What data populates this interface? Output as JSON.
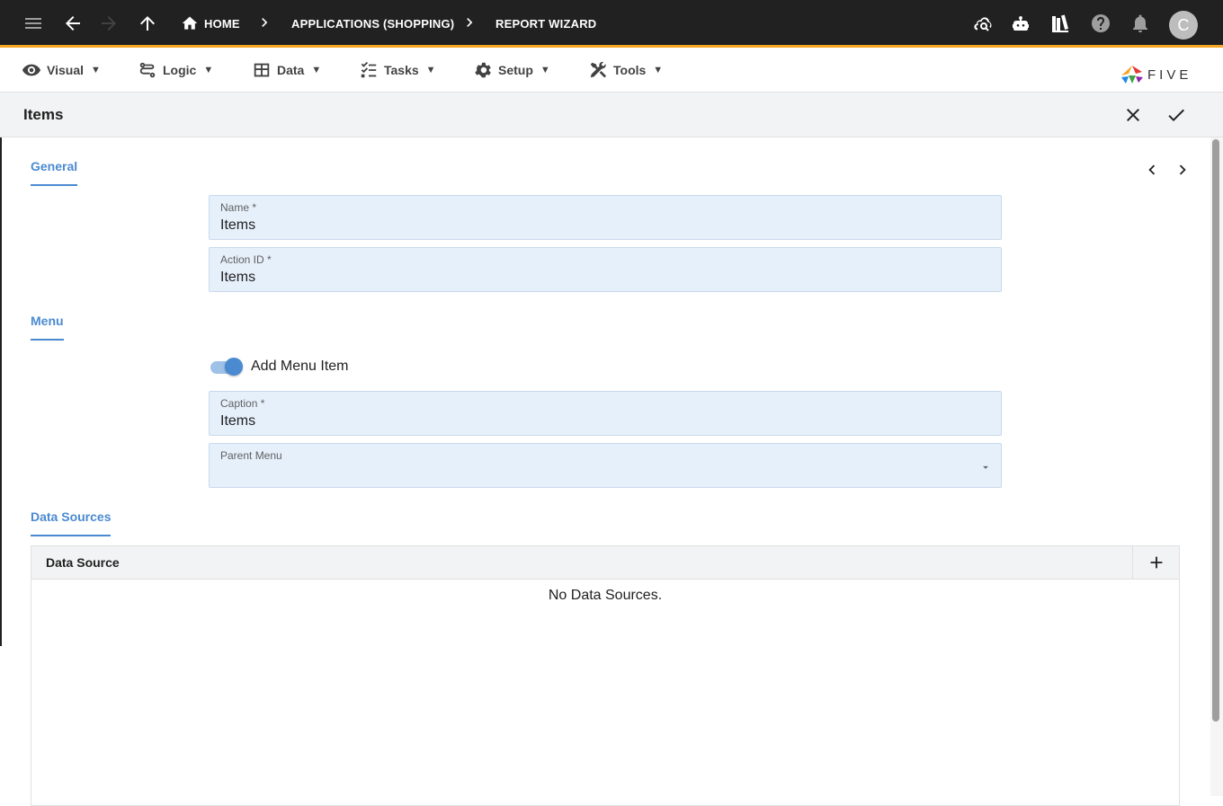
{
  "topbar": {
    "breadcrumbs": [
      "HOME",
      "APPLICATIONS (SHOPPING)",
      "REPORT WIZARD"
    ],
    "avatar_initial": "C"
  },
  "menubar": {
    "items": [
      {
        "label": "Visual",
        "icon": "eye-icon"
      },
      {
        "label": "Logic",
        "icon": "logic-icon"
      },
      {
        "label": "Data",
        "icon": "table-icon"
      },
      {
        "label": "Tasks",
        "icon": "checklist-icon"
      },
      {
        "label": "Setup",
        "icon": "gear-icon"
      },
      {
        "label": "Tools",
        "icon": "tools-icon"
      }
    ],
    "caret": "▼",
    "logo_text": "FIVE"
  },
  "header": {
    "title": "Items"
  },
  "general": {
    "section_title": "General",
    "name_label": "Name *",
    "name_value": "Items",
    "action_label": "Action ID *",
    "action_value": "Items"
  },
  "menu": {
    "section_title": "Menu",
    "toggle_label": "Add Menu Item",
    "toggle_on": true,
    "caption_label": "Caption *",
    "caption_value": "Items",
    "parent_label": "Parent Menu",
    "parent_value": ""
  },
  "data_sources": {
    "section_title": "Data Sources",
    "column": "Data Source",
    "empty_text": "No Data Sources."
  },
  "colors": {
    "topbar": "#212121",
    "accent_bar": "#f5a623",
    "section": "#4a8ad1",
    "field_bg": "#e6f0fb"
  }
}
